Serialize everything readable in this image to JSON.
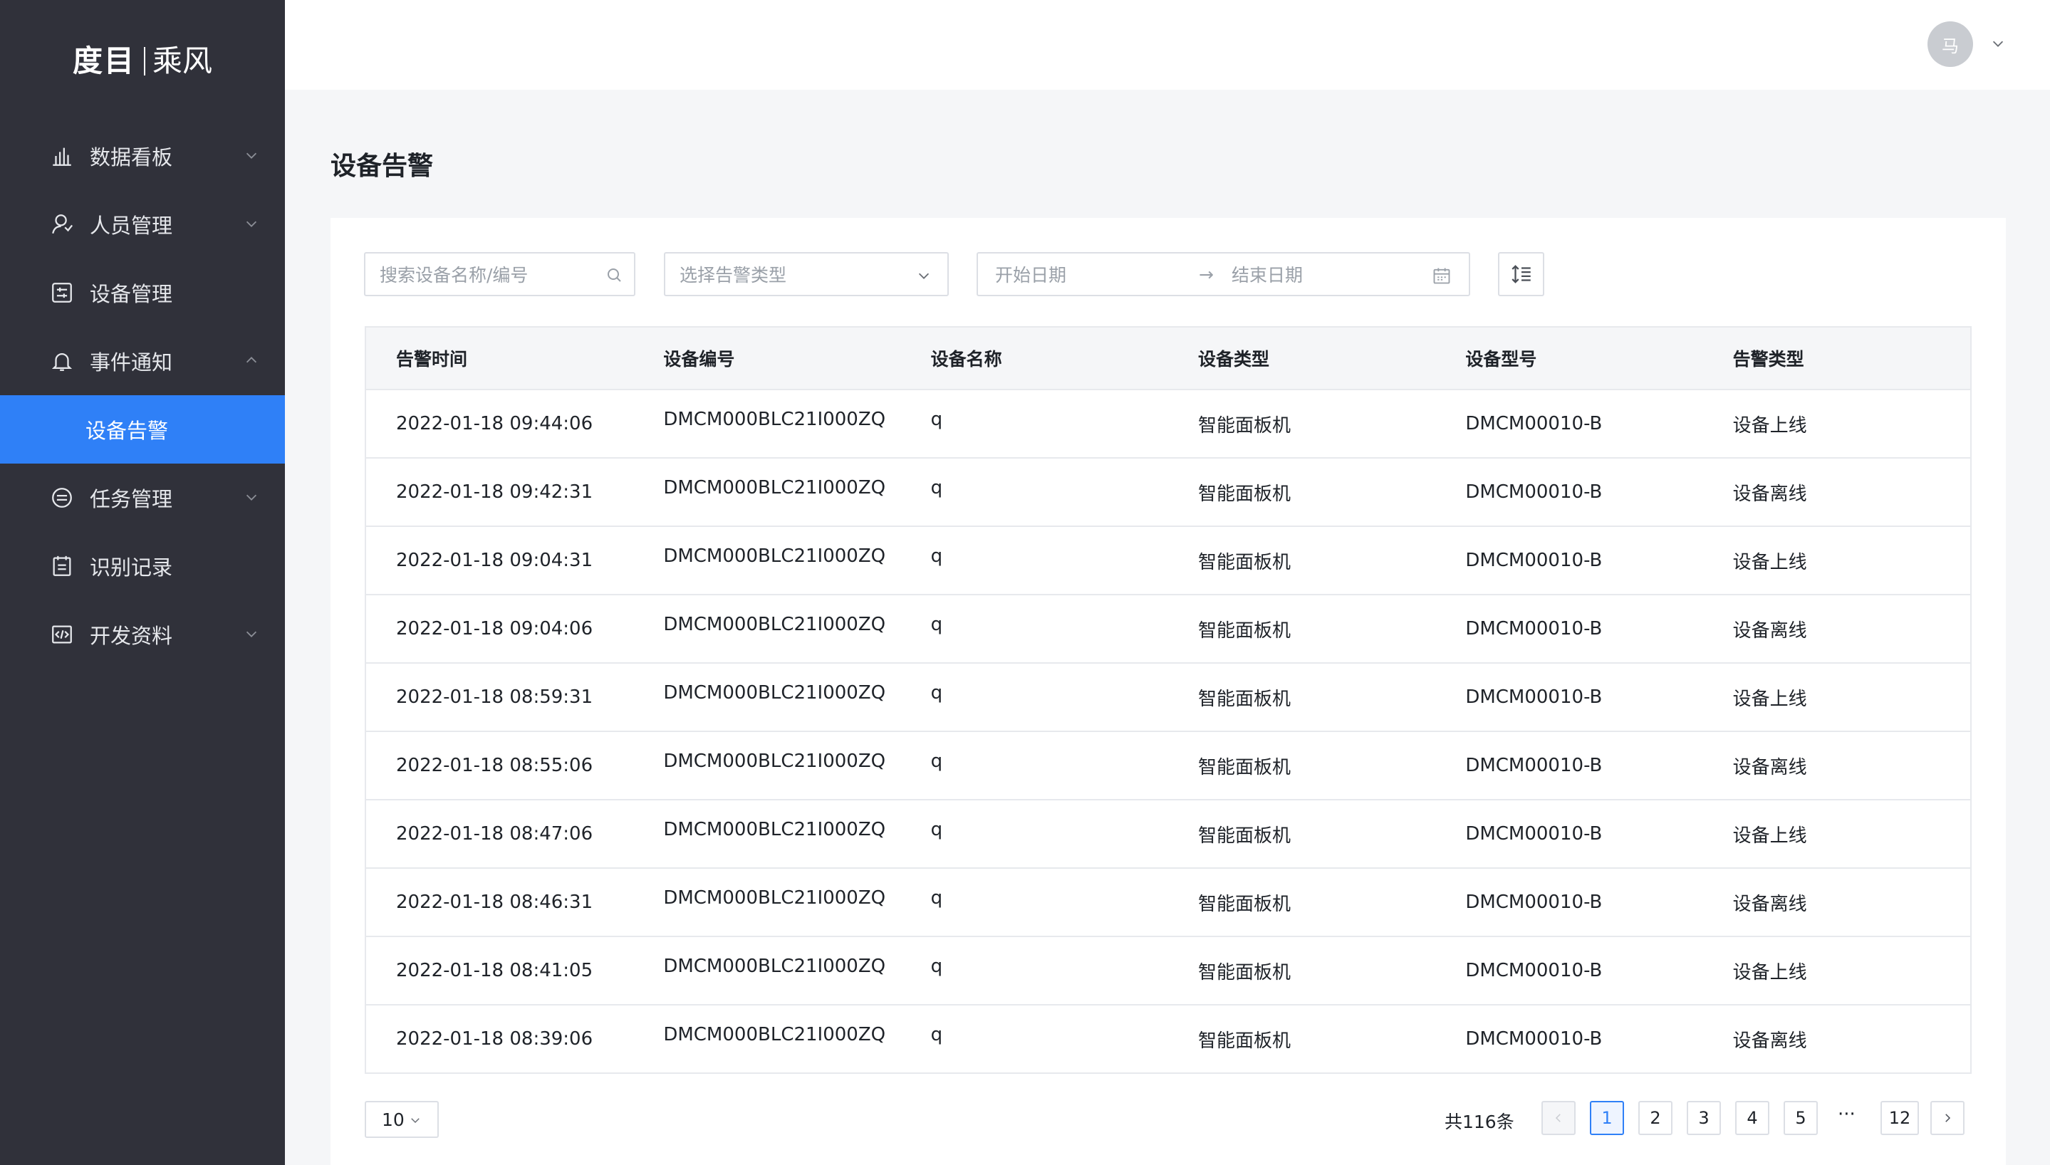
{
  "brand": {
    "name": "度目",
    "product": "乘风"
  },
  "sidebar": {
    "items": [
      {
        "label": "数据看板",
        "icon": "bar-chart-icon",
        "expandable": true
      },
      {
        "label": "人员管理",
        "icon": "user-icon",
        "expandable": true
      },
      {
        "label": "设备管理",
        "icon": "device-icon",
        "expandable": false
      },
      {
        "label": "事件通知",
        "icon": "bell-icon",
        "expandable": true,
        "expanded": true
      },
      {
        "label": "设备告警",
        "sub": true,
        "active": true
      },
      {
        "label": "任务管理",
        "icon": "task-icon",
        "expandable": true
      },
      {
        "label": "识别记录",
        "icon": "calendar-icon",
        "expandable": false
      },
      {
        "label": "开发资料",
        "icon": "code-icon",
        "expandable": true
      }
    ]
  },
  "header": {
    "avatar_text": "马"
  },
  "page": {
    "title": "设备告警"
  },
  "filters": {
    "search_placeholder": "搜索设备名称/编号",
    "type_placeholder": "选择告警类型",
    "date_start_placeholder": "开始日期",
    "date_arrow": "→",
    "date_end_placeholder": "结束日期"
  },
  "table": {
    "columns": [
      "告警时间",
      "设备编号",
      "设备名称",
      "设备类型",
      "设备型号",
      "告警类型"
    ],
    "rows": [
      [
        "2022-01-18 09:44:06",
        "DMCM000BLC21I000ZQ",
        "q",
        "智能面板机",
        "DMCM00010-B",
        "设备上线"
      ],
      [
        "2022-01-18 09:42:31",
        "DMCM000BLC21I000ZQ",
        "q",
        "智能面板机",
        "DMCM00010-B",
        "设备离线"
      ],
      [
        "2022-01-18 09:04:31",
        "DMCM000BLC21I000ZQ",
        "q",
        "智能面板机",
        "DMCM00010-B",
        "设备上线"
      ],
      [
        "2022-01-18 09:04:06",
        "DMCM000BLC21I000ZQ",
        "q",
        "智能面板机",
        "DMCM00010-B",
        "设备离线"
      ],
      [
        "2022-01-18 08:59:31",
        "DMCM000BLC21I000ZQ",
        "q",
        "智能面板机",
        "DMCM00010-B",
        "设备上线"
      ],
      [
        "2022-01-18 08:55:06",
        "DMCM000BLC21I000ZQ",
        "q",
        "智能面板机",
        "DMCM00010-B",
        "设备离线"
      ],
      [
        "2022-01-18 08:47:06",
        "DMCM000BLC21I000ZQ",
        "q",
        "智能面板机",
        "DMCM00010-B",
        "设备上线"
      ],
      [
        "2022-01-18 08:46:31",
        "DMCM000BLC21I000ZQ",
        "q",
        "智能面板机",
        "DMCM00010-B",
        "设备离线"
      ],
      [
        "2022-01-18 08:41:05",
        "DMCM000BLC21I000ZQ",
        "q",
        "智能面板机",
        "DMCM00010-B",
        "设备上线"
      ],
      [
        "2022-01-18 08:39:06",
        "DMCM000BLC21I000ZQ",
        "q",
        "智能面板机",
        "DMCM00010-B",
        "设备离线"
      ]
    ]
  },
  "pagination": {
    "page_size": "10",
    "total": "共116条",
    "pages": [
      "1",
      "2",
      "3",
      "4",
      "5"
    ],
    "ellipsis": "···",
    "last_page": "12",
    "current": "1"
  },
  "colors": {
    "sidebar_bg": "#30313a",
    "accent": "#2f80f7",
    "page_bg": "#f5f6f8"
  }
}
